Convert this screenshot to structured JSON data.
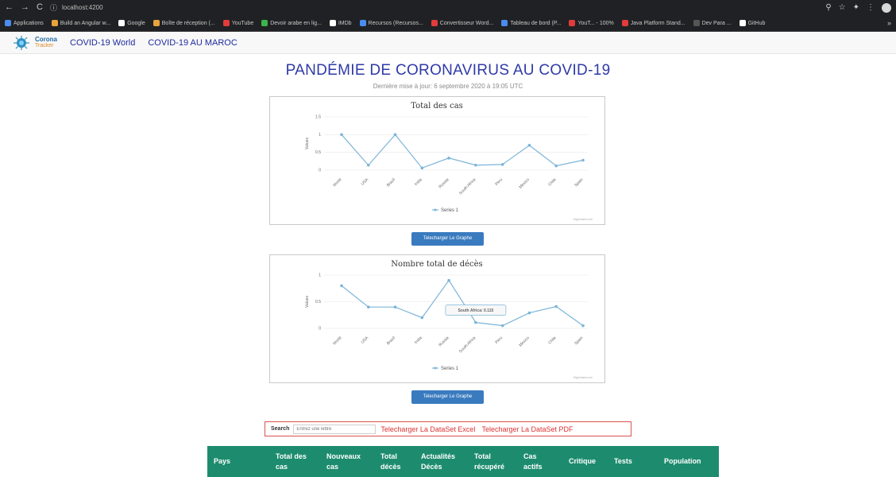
{
  "browser": {
    "nav_back": "←",
    "nav_forward": "→",
    "reload": "C",
    "url": "localhost:4200",
    "bookmarks": [
      {
        "label": "Applications",
        "color": "#4a8cf0"
      },
      {
        "label": "Build an Angular w...",
        "color": "#e8a33d"
      },
      {
        "label": "Google",
        "color": "#ffffff"
      },
      {
        "label": "Boîte de réception (...",
        "color": "#e8a33d"
      },
      {
        "label": "YouTube",
        "color": "#e23b3b"
      },
      {
        "label": "Devoir arabe en lig...",
        "color": "#3bb54a"
      },
      {
        "label": "IMDb",
        "color": "#ffffff"
      },
      {
        "label": "Recursos (Recursos...",
        "color": "#4a8cf0"
      },
      {
        "label": "Convertisseur Word...",
        "color": "#e23b3b"
      },
      {
        "label": "Tableau de bord (P...",
        "color": "#4a8cf0"
      },
      {
        "label": "YouT... - 100%",
        "color": "#e23b3b"
      },
      {
        "label": "Java Platform Stand...",
        "color": "#e23b3b"
      },
      {
        "label": "Dev Para ...",
        "color": "#555555"
      },
      {
        "label": "GitHub",
        "color": "#ffffff"
      }
    ]
  },
  "navbar": {
    "logo_line1": "Corona",
    "logo_line2": "Tracker",
    "links": [
      "COVID-19 World",
      "COVID-19 AU MAROC"
    ]
  },
  "header": {
    "title": "PANDÉMIE DE CORONAVIRUS AU COVID-19",
    "subtitle": "Dernière mise à jour: 6 septembre 2020 à 19:05 UTC"
  },
  "chart_data": [
    {
      "type": "line",
      "title": "Total des cas",
      "xlabel": "",
      "ylabel": "Values",
      "categories": [
        "World",
        "USA",
        "Brazil",
        "India",
        "Russia",
        "South Africa",
        "Peru",
        "Mexico",
        "Chile",
        "Spain"
      ],
      "series": [
        {
          "name": "Series 1",
          "values": [
            1.0,
            0.14,
            1.0,
            0.06,
            0.34,
            0.14,
            0.16,
            0.7,
            0.12,
            0.28
          ]
        }
      ],
      "ylim": [
        0,
        1.5
      ],
      "yticks": [
        "0",
        "0.5",
        "1",
        "1.5"
      ],
      "grid": true,
      "legend": "bottom"
    },
    {
      "type": "line",
      "title": "Nombre total de décès",
      "xlabel": "",
      "ylabel": "Values",
      "categories": [
        "World",
        "USA",
        "Brazil",
        "India",
        "Russia",
        "South Africa",
        "Peru",
        "Mexico",
        "Chile",
        "Spain"
      ],
      "series": [
        {
          "name": "Series 1",
          "values": [
            0.8,
            0.4,
            0.4,
            0.2,
            0.9,
            0.11,
            0.05,
            0.29,
            0.41,
            0.05
          ]
        }
      ],
      "ylim": [
        0,
        1
      ],
      "yticks": [
        "0",
        "0.5",
        "1"
      ],
      "grid": true,
      "legend": "bottom",
      "tooltip": "South Africa: 0.115"
    }
  ],
  "chart_credit": "Highcharts.com",
  "download_graph_label": "Telecharger Le Graphe",
  "search": {
    "label": "Search",
    "placeholder": "Entrez une lettre",
    "excel_label": "Telecharger La DataSet Excel",
    "pdf_label": "Telecharger La DataSet PDF"
  },
  "table": {
    "headers": [
      "Pays",
      "Total des cas",
      "Nouveaux cas",
      "Total décès",
      "Actualités Décès",
      "Total récupéré",
      "Cas actifs",
      "Critique",
      "Tests",
      "Population"
    ],
    "header_color": "#1d8c6e"
  },
  "colors": {
    "accent": "#2f3aa8",
    "line": "#7cb5d8",
    "button": "#3a7bbf",
    "danger": "#d33333"
  }
}
